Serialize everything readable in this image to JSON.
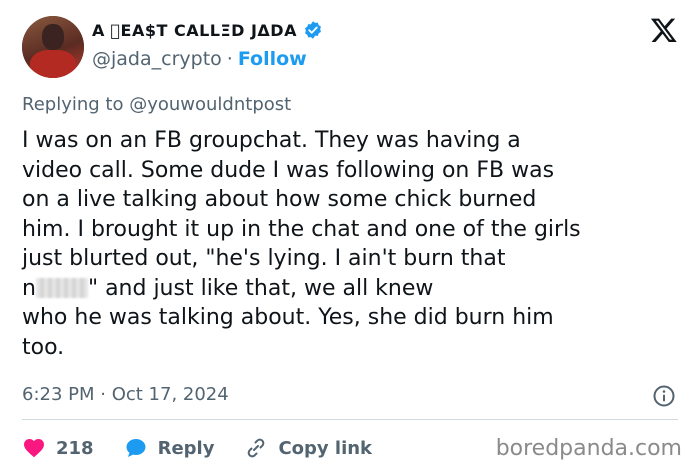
{
  "header": {
    "display_name": "A ⃞EA$T CALLΞD JΔDA",
    "handle": "@jada_crypto",
    "separator": "·",
    "follow_label": "Follow"
  },
  "reply_context": {
    "prefix": "Replying to",
    "mention": "@youwouldntpost"
  },
  "tweet": {
    "lines": [
      "I was on an FB groupchat. They was having a",
      "video call. Some dude I was following on FB was",
      "on a live talking about how some chick burned",
      "him. I brought it up in the chat and one of the girls",
      "just blurted out, \"he's lying. I ain't burn that",
      "n",
      "\" and just like that, we all knew",
      "who he was talking about. Yes, she did burn him",
      "too."
    ],
    "timestamp": "6:23 PM · Oct 17, 2024"
  },
  "actions": {
    "like_count": "218",
    "reply_label": "Reply",
    "copy_link_label": "Copy link"
  },
  "watermark": "boredpanda.com",
  "colors": {
    "accent": "#1d9bf0",
    "like": "#f91880",
    "muted": "#536471",
    "text": "#0f1419"
  },
  "icons": [
    "verified-badge-icon",
    "x-logo-icon",
    "info-icon",
    "heart-icon",
    "reply-bubble-icon",
    "link-icon"
  ]
}
